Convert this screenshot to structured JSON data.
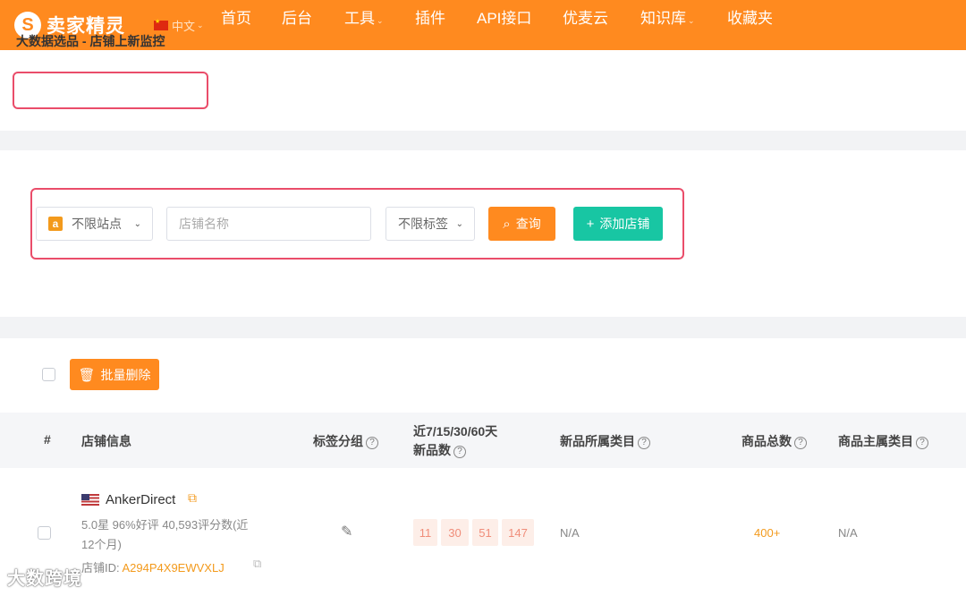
{
  "nav": {
    "brand": "卖家精灵",
    "logo_letter": "S",
    "language": "中文",
    "items": [
      {
        "label": "首页",
        "dropdown": false
      },
      {
        "label": "后台",
        "dropdown": false
      },
      {
        "label": "工具",
        "dropdown": true
      },
      {
        "label": "插件",
        "dropdown": false
      },
      {
        "label": "API接口",
        "dropdown": false
      },
      {
        "label": "优麦云",
        "dropdown": false
      },
      {
        "label": "知识库",
        "dropdown": true
      },
      {
        "label": "收藏夹",
        "dropdown": false
      }
    ]
  },
  "page": {
    "title": "大数据选品 - 店铺上新监控"
  },
  "filters": {
    "site_select": "不限站点",
    "site_icon": "a",
    "store_name_placeholder": "店铺名称",
    "tag_select": "不限标签",
    "search_button": "查询",
    "add_store_button": "添加店铺"
  },
  "toolbar": {
    "bulk_delete": "批量删除"
  },
  "table": {
    "headers": {
      "index": "#",
      "store_info": "店铺信息",
      "tag_group": "标签分组",
      "new_count_line1": "近7/15/30/60天",
      "new_count_line2": "新品数",
      "new_category": "新品所属类目",
      "total_products": "商品总数",
      "main_category": "商品主属类目"
    },
    "rows": [
      {
        "store_name": "AnkerDirect",
        "rating_line1": "5.0星  96%好评  40,593评分数(近",
        "rating_line2": "12个月)",
        "store_id_label": "店铺ID: ",
        "store_id": "A294P4X9EWVXLJ",
        "new_counts": [
          "11",
          "30",
          "51",
          "147"
        ],
        "new_category": "N/A",
        "total_products": "400+",
        "main_category": "N/A"
      }
    ]
  },
  "watermark": "大数跨境",
  "colors": {
    "brand_orange": "#ff8a1f",
    "add_green": "#18c6a3",
    "highlight_red": "#ea4d6a"
  }
}
